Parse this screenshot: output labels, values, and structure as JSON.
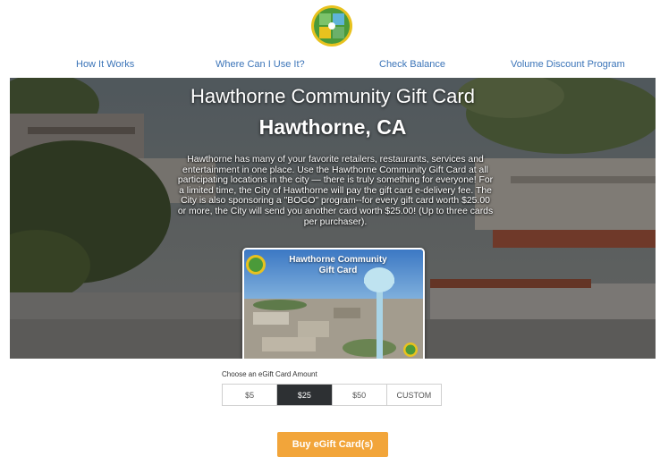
{
  "nav": {
    "how_it_works": "How It Works",
    "where_can_i_use_it": "Where Can I Use It?",
    "check_balance": "Check Balance",
    "volume_discount": "Volume Discount Program"
  },
  "hero": {
    "title": "Hawthorne Community Gift Card",
    "subtitle": "Hawthorne, CA",
    "description": "Hawthorne has many of your favorite retailers, restaurants, services and entertainment in one place. Use the Hawthorne Community Gift Card at all participating locations in the city — there is truly something for everyone! For a limited time, the City of Hawthorne will pay the gift card e-delivery fee. The City is also sponsoring a \"BOGO\" program--for every gift card worth $25.00 or more, the City will send you another card worth $25.00! (Up to three cards per purchaser)."
  },
  "card": {
    "title_line1": "Hawthorne Community",
    "title_line2": "Gift Card"
  },
  "amount": {
    "label": "Choose an eGift Card Amount",
    "options": [
      "$5",
      "$25",
      "$50",
      "CUSTOM"
    ],
    "selected": "$25"
  },
  "buy_button": "Buy eGift Card(s)",
  "colors": {
    "nav_link": "#3b74b8",
    "selected_option": "#2d3033",
    "buy_button": "#f2a53a",
    "logo_green": "#4b9a3a",
    "logo_yellow": "#e8c21e"
  }
}
